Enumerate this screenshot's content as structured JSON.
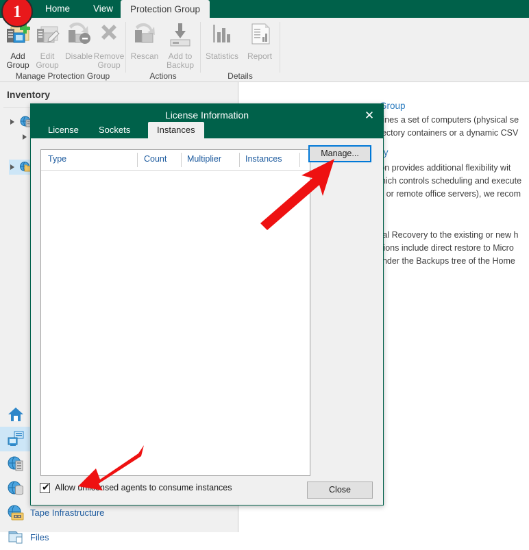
{
  "badge": {
    "number": "1"
  },
  "ribbon": {
    "tabs": [
      {
        "label": "Home",
        "active": false
      },
      {
        "label": "View",
        "active": false
      },
      {
        "label": "Protection Group",
        "active": true
      }
    ],
    "groups": [
      {
        "label": "Manage Protection Group",
        "buttons": [
          {
            "label_line1": "Add",
            "label_line2": "Group",
            "icon": "add-group-icon",
            "enabled": true
          },
          {
            "label_line1": "Edit",
            "label_line2": "Group",
            "icon": "edit-group-icon",
            "enabled": false
          },
          {
            "label_line1": "Disable",
            "label_line2": "",
            "icon": "disable-group-icon",
            "enabled": false
          },
          {
            "label_line1": "Remove",
            "label_line2": "Group",
            "icon": "remove-group-icon",
            "enabled": false
          }
        ]
      },
      {
        "label": "Actions",
        "buttons": [
          {
            "label_line1": "Rescan",
            "label_line2": "",
            "icon": "rescan-icon",
            "enabled": false
          },
          {
            "label_line1": "Add to",
            "label_line2": "Backup",
            "icon": "add-to-backup-icon",
            "enabled": false
          }
        ]
      },
      {
        "label": "Details",
        "buttons": [
          {
            "label_line1": "Statistics",
            "label_line2": "",
            "icon": "statistics-icon",
            "enabled": false
          },
          {
            "label_line1": "Report",
            "label_line2": "",
            "icon": "report-icon",
            "enabled": false
          }
        ]
      }
    ]
  },
  "left_pane": {
    "title": "Inventory",
    "nav_items": [
      {
        "label": "Home",
        "icon": "home-icon",
        "selected": false
      },
      {
        "label": "Inventory",
        "icon": "inventory-icon",
        "selected": true
      },
      {
        "label": "Backup Infrastructure",
        "icon": "backup-infrastructure-icon",
        "selected": false
      },
      {
        "label": "Storage Infrastructure",
        "icon": "storage-infrastructure-icon",
        "selected": false
      },
      {
        "label": "Tape Infrastructure",
        "icon": "tape-infrastructure-icon",
        "selected": false
      },
      {
        "label": "Files",
        "icon": "files-icon",
        "selected": false
      }
    ]
  },
  "right_pane": {
    "heading1": "Group",
    "line1": "efines a set of computers (physical se",
    "line2": "irectory containers or a dynamic CSV",
    "heading2": "cy",
    "line3": "tion provides additional flexibility wit",
    "line4": "which controls scheduling and execute",
    "line5": "os or remote office servers), we recom",
    "line6": "etal Recovery to the existing or new h",
    "line7": "ptions include direct restore to Micro",
    "line8": "under the Backups tree of the Home"
  },
  "dialog": {
    "title": "License Information",
    "close_icon": "close-icon",
    "tabs": [
      {
        "label": "License",
        "active": false
      },
      {
        "label": "Sockets",
        "active": false
      },
      {
        "label": "Instances",
        "active": true
      }
    ],
    "grid": {
      "columns": [
        "Type",
        "Count",
        "Multiplier",
        "Instances"
      ],
      "rows": []
    },
    "manage_button": "Manage...",
    "checkbox": {
      "label": "Allow unlicensed agents to consume instances",
      "checked": true,
      "mark": "✔"
    },
    "close_button": "Close"
  },
  "colors": {
    "ribbon_green": "#00614a",
    "accent_blue": "#0078d7",
    "link_blue": "#1c5a9e",
    "badge_red": "#e8191b"
  }
}
